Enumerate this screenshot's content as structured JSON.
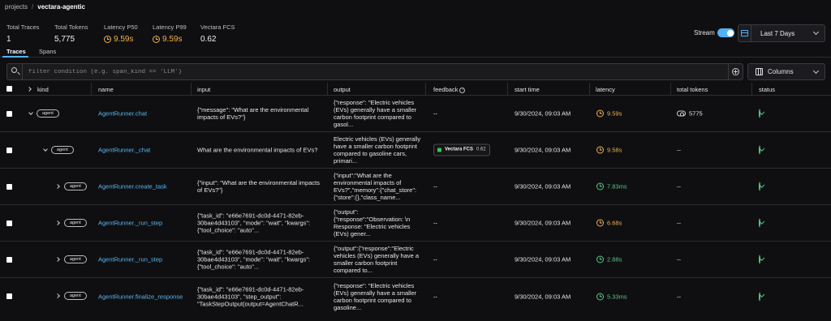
{
  "breadcrumb": {
    "root": "projects",
    "separator": "/",
    "current": "vectara-agentic"
  },
  "stats": [
    {
      "label": "Total Traces",
      "value": "1"
    },
    {
      "label": "Total Tokens",
      "value": "5,775"
    },
    {
      "label": "Latency P50",
      "value": "9.59s"
    },
    {
      "label": "Latency P99",
      "value": "9.59s"
    },
    {
      "label": "Vectara FCS",
      "value": "0.62"
    }
  ],
  "controls": {
    "stream_label": "Stream",
    "stream_on": true,
    "date_range": "Last 7 Days",
    "columns_label": "Columns"
  },
  "tabs": [
    {
      "label": "Traces",
      "active": true
    },
    {
      "label": "Spans",
      "active": false
    }
  ],
  "filter": {
    "placeholder": "filter condition (e.g. span_kind == 'LLM')",
    "value": ""
  },
  "columns": [
    "kind",
    "name",
    "input",
    "output",
    "feedback",
    "start time",
    "latency",
    "total tokens",
    "status"
  ],
  "rows": [
    {
      "kind": "agent",
      "name": "AgentRunner.chat",
      "input": "{\"message\": \"What are the environmental impacts of EVs?\"}",
      "output": "{\"response\": \"Electric vehicles (EVs) generally have a smaller carbon footprint compared to gasol...",
      "feedback": "--",
      "start_time": "9/30/2024, 09:03 AM",
      "latency": "9.59s",
      "latency_color": "orange",
      "total_tokens": "5775",
      "status": "ok"
    },
    {
      "kind": "agent",
      "name": "AgentRunner._chat",
      "input": "What are the environmental impacts of EVs?",
      "output": "Electric vehicles (EVs) generally have a smaller carbon footprint compared to gasoline cars, primari...",
      "feedback": {
        "label": "Vectara FCS",
        "value": "0.62"
      },
      "start_time": "9/30/2024, 09:03 AM",
      "latency": "9.58s",
      "latency_color": "orange",
      "total_tokens": "--",
      "status": "ok"
    },
    {
      "kind": "agent",
      "name": "AgentRunner.create_task",
      "input": "{\"input\": \"What are the environmental impacts of EVs?\"}",
      "output": "{\"input\":\"What are the environmental impacts of EVs?\",\"memory\":{\"chat_store\":{\"store\":{},\"class_name...",
      "feedback": "--",
      "start_time": "9/30/2024, 09:03 AM",
      "latency": "7.83ms",
      "latency_color": "green",
      "total_tokens": "--",
      "status": "ok"
    },
    {
      "kind": "agent",
      "name": "AgentRunner._run_step",
      "input": "{\"task_id\": \"e66e7691-dc0d-4471-82eb-30bae4d43103\", \"mode\": \"wait\", \"kwargs\": {\"tool_choice\": \"auto\"...",
      "output": "{\"output\":{\"response\":\"Observation: \\n Response: \"Electric vehicles (EVs) gener...",
      "feedback": "--",
      "start_time": "9/30/2024, 09:03 AM",
      "latency": "6.68s",
      "latency_color": "orange",
      "total_tokens": "--",
      "status": "ok"
    },
    {
      "kind": "agent",
      "name": "AgentRunner._run_step",
      "input": "{\"task_id\": \"e66e7691-dc0d-4471-82eb-30bae4d43103\", \"mode\": \"wait\", \"kwargs\": {\"tool_choice\": \"auto\"...",
      "output": "{\"output\":{\"response\":\"Electric vehicles (EVs) generally have a smaller carbon footprint compared to...",
      "feedback": "--",
      "start_time": "9/30/2024, 09:03 AM",
      "latency": "2.88s",
      "latency_color": "green",
      "total_tokens": "--",
      "status": "ok"
    },
    {
      "kind": "agent",
      "name": "AgentRunner.finalize_response",
      "input": "{\"task_id\": \"e66e7691-dc0d-4471-82eb-30bae4d43103\", \"step_output\": \"TaskStepOutput(output=AgentChatR...",
      "output": "{\"response\": \"Electric vehicles (EVs) generally have a smaller carbon footprint compared to gasoline...",
      "feedback": "--",
      "start_time": "9/30/2024, 09:03 AM",
      "latency": "5.33ms",
      "latency_color": "green",
      "total_tokens": "--",
      "status": "ok"
    }
  ]
}
